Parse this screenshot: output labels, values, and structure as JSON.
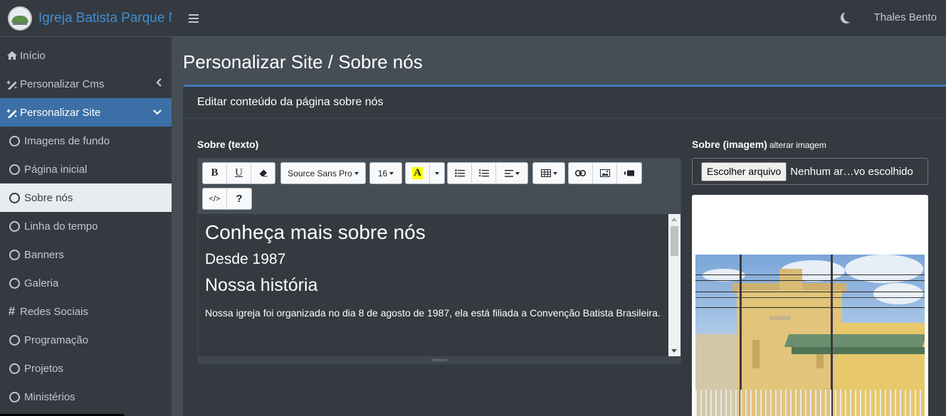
{
  "brand": {
    "name": "Igreja Batista Parque Nova"
  },
  "topbar": {
    "menu_icon": "bars-icon",
    "theme_icon": "moon-icon",
    "user_name": "Thales Bento"
  },
  "sidebar": {
    "items": [
      {
        "label": "Início",
        "icon": "home-icon"
      },
      {
        "label": "Personalizar Cms",
        "icon": "magic-wand-icon"
      },
      {
        "label": "Personalizar Site",
        "icon": "magic-wand-icon"
      },
      {
        "label": "Imagens de fundo",
        "icon": "circle-icon"
      },
      {
        "label": "Página inicial",
        "icon": "circle-icon"
      },
      {
        "label": "Sobre nós",
        "icon": "circle-icon"
      },
      {
        "label": "Linha do tempo",
        "icon": "circle-icon"
      },
      {
        "label": "Banners",
        "icon": "circle-icon"
      },
      {
        "label": "Galeria",
        "icon": "circle-icon"
      },
      {
        "label": "Redes Sociais",
        "icon": "hashtag-icon"
      },
      {
        "label": "Programação",
        "icon": "circle-icon"
      },
      {
        "label": "Projetos",
        "icon": "circle-icon"
      },
      {
        "label": "Ministérios",
        "icon": "circle-icon"
      }
    ]
  },
  "main": {
    "page_title": "Personalizar Site / Sobre nós",
    "card_title": "Editar conteúdo da página sobre nós",
    "text_label": "Sobre (texto)",
    "image_label": "Sobre (imagem)",
    "image_label_hint": "alterar imagem",
    "toolbar": {
      "bold": "B",
      "underline": "U",
      "font_family": "Source Sans Pro",
      "font_size": "16",
      "color": "A",
      "code": "</>",
      "help": "?"
    },
    "editor": {
      "heading1": "Conheça mais sobre nós",
      "heading2": "Desde 1987",
      "heading3": "Nossa história",
      "paragraph": "Nossa igreja foi organizada no dia 8 de agosto de 1987, ela está filiada a Convenção Batista Brasileira."
    },
    "file_input": {
      "button_label": "Escolher arquivo",
      "status": "Nenhum ar…vo escolhido"
    }
  },
  "colors": {
    "accent": "#3f7ab8",
    "sidebar_bg": "#343a40",
    "content_bg": "#454d55",
    "brand_text": "#3f8fd6"
  }
}
